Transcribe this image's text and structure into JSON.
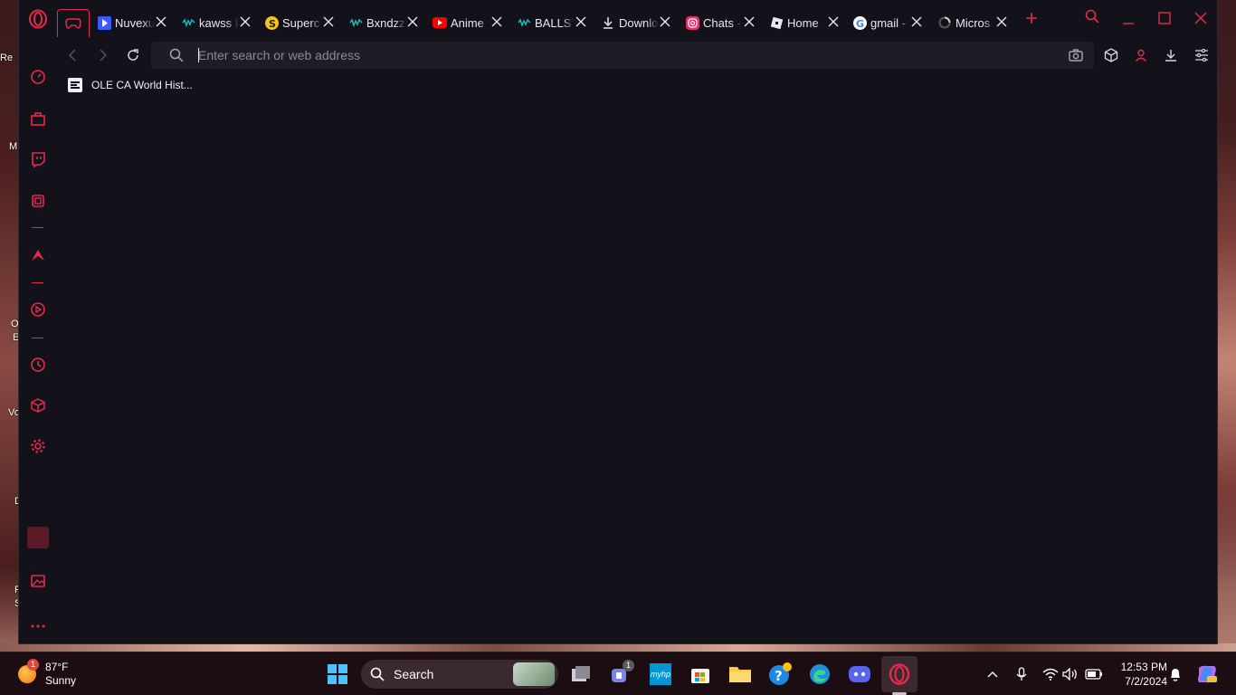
{
  "desktop": {
    "labels": [
      "Re",
      "M",
      "O",
      "E",
      "Vo",
      "D",
      "F",
      "S"
    ]
  },
  "browser": {
    "tabs": [
      {
        "title": "Nuvexu",
        "icon": "play-icon",
        "color": "#3a5bff"
      },
      {
        "title": "kawss F",
        "icon": "soundwave-icon",
        "color": "#22b8b8"
      },
      {
        "title": "Superc",
        "icon": "s-coin-icon",
        "color": "#f5c518"
      },
      {
        "title": "Bxndzz",
        "icon": "soundwave-icon",
        "color": "#22b8b8"
      },
      {
        "title": "Anime",
        "icon": "youtube-icon",
        "color": "#ff0000"
      },
      {
        "title": "BALLST",
        "icon": "soundwave-icon",
        "color": "#22b8b8"
      },
      {
        "title": "Downlo",
        "icon": "download-icon",
        "color": "#e8e6ee"
      },
      {
        "title": "Chats -",
        "icon": "instagram-icon",
        "color": "#e1306c"
      },
      {
        "title": "Home",
        "icon": "roblox-icon",
        "color": "#e8e6ee"
      },
      {
        "title": "gmail -",
        "icon": "google-icon",
        "color": "#4285f4"
      },
      {
        "title": "Micros",
        "icon": "loading-icon",
        "color": "#aaaaaa"
      }
    ],
    "address": {
      "placeholder": "Enter search or web address",
      "value": ""
    },
    "bookmarks": [
      {
        "label": "OLE CA World Hist..."
      }
    ],
    "accent": "#e6294a"
  },
  "taskbar": {
    "weather": {
      "temp": "87°F",
      "condition": "Sunny",
      "badge": "1"
    },
    "search_label": "Search",
    "teams_badge": "1",
    "hp_label": "myhp",
    "time": "12:53 PM",
    "date": "7/2/2024"
  }
}
